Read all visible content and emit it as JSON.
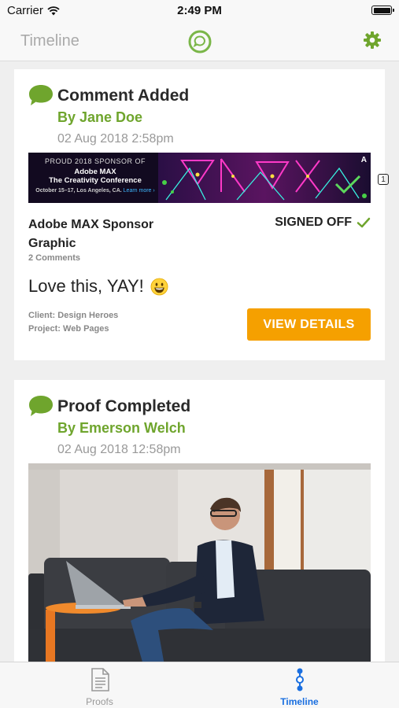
{
  "status_bar": {
    "carrier": "Carrier",
    "time": "2:49 PM"
  },
  "nav": {
    "title": "Timeline",
    "logo_icon": "proof-logo-icon",
    "settings_icon": "gear-icon"
  },
  "colors": {
    "accent_green": "#6fa52d",
    "button_orange": "#f5a000",
    "tab_active": "#1a6fe0"
  },
  "feed": [
    {
      "icon": "comment-bubble-icon",
      "title": "Comment Added",
      "author": "By Jane Doe",
      "timestamp": "02 Aug 2018 2:58pm",
      "banner": {
        "line1": "PROUD 2018 SPONSOR OF",
        "line2": "Adobe MAX",
        "line3": "The Creativity Conference",
        "line4": "October 15–17, Los Angeles, CA.",
        "link": "Learn more ›"
      },
      "badge": "1",
      "asset_name": "Adobe MAX Sponsor Graphic",
      "status": "SIGNED OFF",
      "comments": "2 Comments",
      "comment_text": "Love this, YAY!",
      "client": "Client: Design Heroes",
      "project": "Project: Web Pages",
      "button": "VIEW DETAILS"
    },
    {
      "icon": "comment-bubble-icon",
      "title": "Proof Completed",
      "author": "By Emerson Welch",
      "timestamp": "02 Aug 2018 12:58pm"
    }
  ],
  "tabs": [
    {
      "label": "Proofs",
      "icon": "document-icon",
      "active": false
    },
    {
      "label": "Timeline",
      "icon": "timeline-icon",
      "active": true
    }
  ]
}
